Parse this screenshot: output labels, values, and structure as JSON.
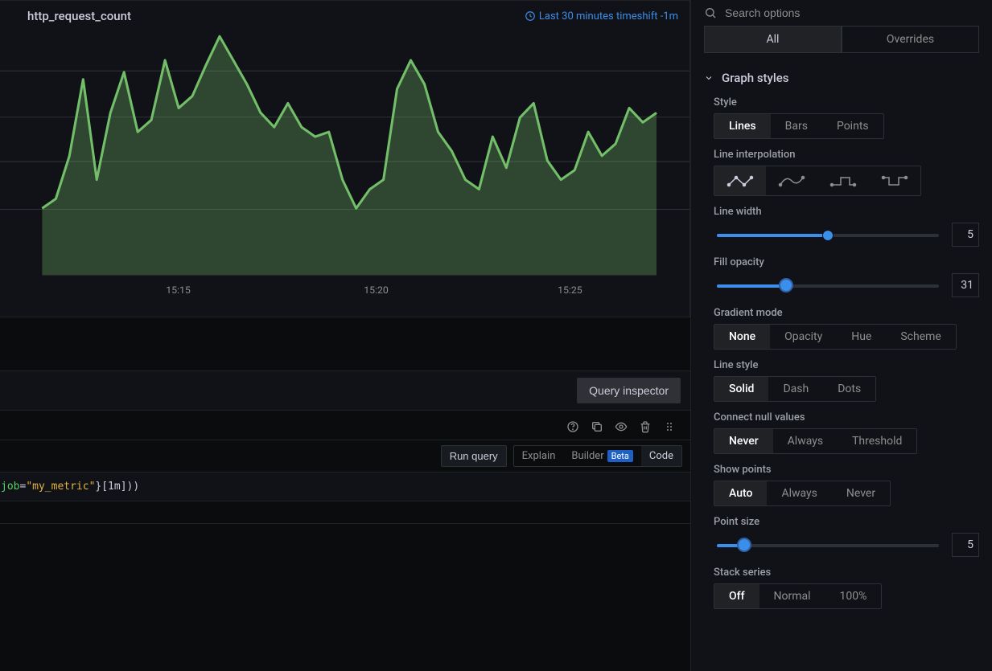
{
  "panel": {
    "title": "http_request_count",
    "time_range": "Last 30 minutes timeshift -1m"
  },
  "chart_data": {
    "type": "area",
    "title": "http_request_count",
    "xlabel": "",
    "ylabel": "",
    "x_tick_labels": [
      "15:15",
      "15:20",
      "15:25"
    ],
    "x_tick_positions": [
      220,
      460,
      695
    ],
    "y_gridlines": [
      52,
      108,
      162,
      220
    ],
    "ylim": [
      0,
      100
    ],
    "series": [
      {
        "name": "http_request_count",
        "color": "#73bf69",
        "values": [
          28,
          32,
          50,
          82,
          40,
          68,
          85,
          60,
          65,
          90,
          70,
          75,
          88,
          100,
          90,
          80,
          68,
          62,
          72,
          62,
          58,
          60,
          40,
          28,
          36,
          40,
          78,
          90,
          80,
          60,
          52,
          40,
          36,
          58,
          45,
          66,
          72,
          48,
          40,
          44,
          60,
          50,
          55,
          70,
          64,
          68
        ]
      }
    ]
  },
  "query": {
    "inspector_btn": "Query inspector",
    "run_btn": "Run query",
    "explain": "Explain",
    "builder": "Builder",
    "beta": "Beta",
    "code": "Code",
    "expr_prefix": "job",
    "expr_eq": "=",
    "expr_value": "\"my_metric\"",
    "expr_suffix": "}[1m]))"
  },
  "sidebar": {
    "search_placeholder": "Search options",
    "tabs": {
      "all": "All",
      "overrides": "Overrides"
    },
    "section": "Graph styles",
    "style": {
      "label": "Style",
      "options": [
        "Lines",
        "Bars",
        "Points"
      ],
      "selected": "Lines"
    },
    "interpolation": {
      "label": "Line interpolation"
    },
    "line_width": {
      "label": "Line width",
      "value": 5,
      "max": 10
    },
    "fill_opacity": {
      "label": "Fill opacity",
      "value": 31,
      "max": 100
    },
    "gradient": {
      "label": "Gradient mode",
      "options": [
        "None",
        "Opacity",
        "Hue",
        "Scheme"
      ],
      "selected": "None"
    },
    "line_style": {
      "label": "Line style",
      "options": [
        "Solid",
        "Dash",
        "Dots"
      ],
      "selected": "Solid"
    },
    "connect_null": {
      "label": "Connect null values",
      "options": [
        "Never",
        "Always",
        "Threshold"
      ],
      "selected": "Never"
    },
    "show_points": {
      "label": "Show points",
      "options": [
        "Auto",
        "Always",
        "Never"
      ],
      "selected": "Auto"
    },
    "point_size": {
      "label": "Point size",
      "value": 5,
      "max": 40
    },
    "stack": {
      "label": "Stack series",
      "options": [
        "Off",
        "Normal",
        "100%"
      ],
      "selected": "Off"
    }
  }
}
